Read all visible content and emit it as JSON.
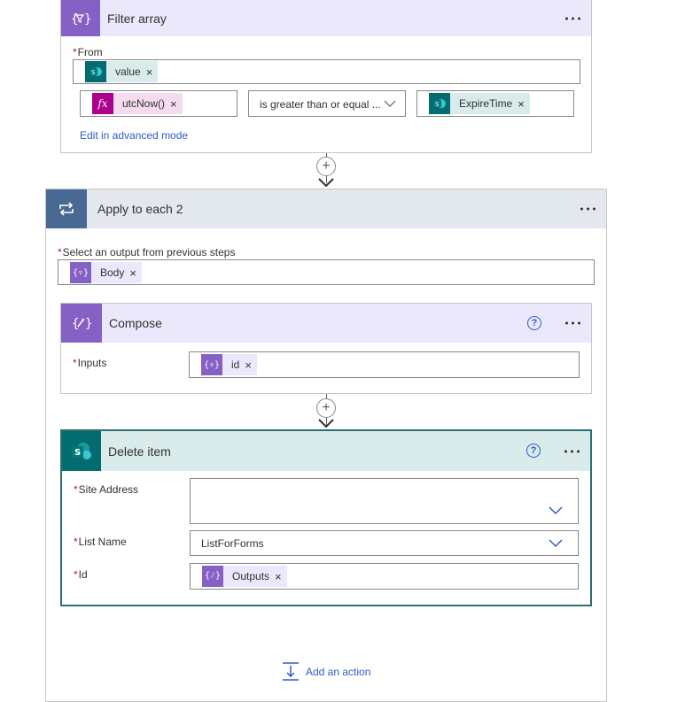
{
  "filter_array": {
    "title": "Filter array",
    "from_label": "From",
    "from_token": "value",
    "left_token": "utcNow()",
    "operator": "is greater than or equal ...",
    "right_token": "ExpireTime",
    "advanced_link": "Edit in advanced mode",
    "token_close": "×"
  },
  "apply_to_each": {
    "title": "Apply to each 2",
    "select_label": "Select an output from previous steps",
    "select_token": "Body"
  },
  "compose": {
    "title": "Compose",
    "inputs_label": "Inputs",
    "inputs_token": "id"
  },
  "delete_item": {
    "title": "Delete item",
    "site_address_label": "Site Address",
    "list_name_label": "List Name",
    "list_name_value": "ListForForms",
    "id_label": "Id",
    "id_token": "Outputs"
  },
  "add_action": {
    "label": "Add an action"
  },
  "required_mark": "*",
  "help_glyph": "?",
  "plus_glyph": "+",
  "colors": {
    "filter_header": "#ece8fc",
    "purple_icon": "#8661c5",
    "apply_header": "#e3e7ee",
    "apply_icon": "#486991",
    "delete_header": "#d9ebeb",
    "sharepoint": "#036c70",
    "delete_border": "#2f6f6e",
    "fx_magenta": "#ad008c",
    "link": "#2f5cc9"
  },
  "icons": [
    "filter-icon",
    "loop-icon",
    "compose-icon",
    "sharepoint-icon",
    "function-icon",
    "expression-icon",
    "chevron-down-icon",
    "help-icon",
    "more-icon",
    "add-action-icon"
  ]
}
